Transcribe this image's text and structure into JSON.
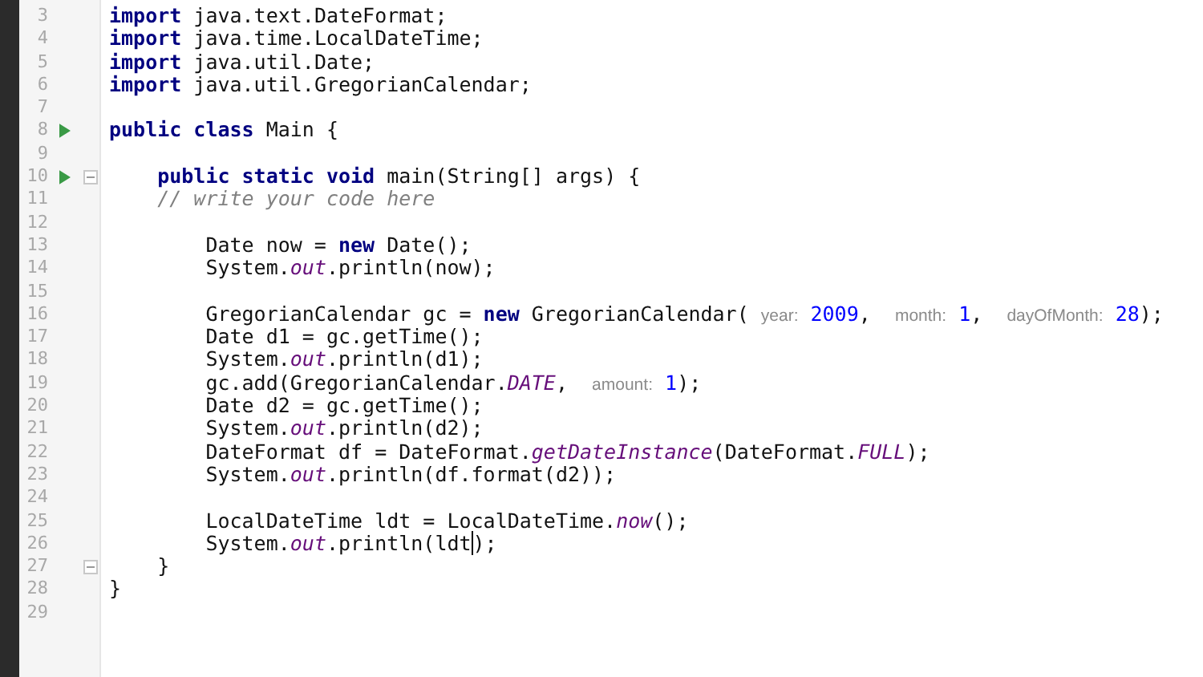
{
  "editor": {
    "lines": [
      {
        "number": "3",
        "run": false,
        "fold": false,
        "tokens": [
          {
            "kind": "kw",
            "text": "import"
          },
          {
            "kind": "plain",
            "text": " java.text.DateFormat;"
          }
        ]
      },
      {
        "number": "4",
        "run": false,
        "fold": false,
        "tokens": [
          {
            "kind": "kw",
            "text": "import"
          },
          {
            "kind": "plain",
            "text": " java.time.LocalDateTime;"
          }
        ]
      },
      {
        "number": "5",
        "run": false,
        "fold": false,
        "tokens": [
          {
            "kind": "kw",
            "text": "import"
          },
          {
            "kind": "plain",
            "text": " java.util.Date;"
          }
        ]
      },
      {
        "number": "6",
        "run": false,
        "fold": false,
        "tokens": [
          {
            "kind": "kw",
            "text": "import"
          },
          {
            "kind": "plain",
            "text": " java.util.GregorianCalendar;"
          }
        ]
      },
      {
        "number": "7",
        "run": false,
        "fold": false
      },
      {
        "number": "8",
        "run": true,
        "fold": false,
        "tokens": [
          {
            "kind": "kw",
            "text": "public class"
          },
          {
            "kind": "plain",
            "text": " Main {"
          }
        ]
      },
      {
        "number": "9",
        "run": false,
        "fold": false
      },
      {
        "number": "10",
        "run": true,
        "fold": true,
        "tokens": [
          {
            "kind": "kw",
            "text": "    public static void"
          },
          {
            "kind": "plain",
            "text": " main(String[] args) {"
          }
        ]
      },
      {
        "number": "11",
        "run": false,
        "fold": false,
        "tokens": [
          {
            "kind": "comment",
            "text": "    // write your code here"
          }
        ]
      },
      {
        "number": "12",
        "run": false,
        "fold": false
      },
      {
        "number": "13",
        "run": false,
        "fold": false,
        "tokens": [
          {
            "kind": "plain",
            "text": "        Date now = "
          },
          {
            "kind": "kw",
            "text": "new"
          },
          {
            "kind": "plain",
            "text": " Date();"
          }
        ]
      },
      {
        "number": "14",
        "run": false,
        "fold": false,
        "tokens": [
          {
            "kind": "plain",
            "text": "        System."
          },
          {
            "kind": "static",
            "text": "out"
          },
          {
            "kind": "plain",
            "text": ".println(now);"
          }
        ]
      },
      {
        "number": "15",
        "run": false,
        "fold": false
      },
      {
        "number": "16",
        "run": false,
        "fold": false,
        "tokens": [
          {
            "kind": "plain",
            "text": "        GregorianCalendar gc = "
          },
          {
            "kind": "kw",
            "text": "new"
          },
          {
            "kind": "plain",
            "text": " GregorianCalendar( "
          },
          {
            "kind": "hint",
            "text": "year:"
          },
          {
            "kind": "num",
            "text": " 2009"
          },
          {
            "kind": "plain",
            "text": ",  "
          },
          {
            "kind": "hint",
            "text": "month:"
          },
          {
            "kind": "num",
            "text": " 1"
          },
          {
            "kind": "plain",
            "text": ",  "
          },
          {
            "kind": "hint",
            "text": "dayOfMonth:"
          },
          {
            "kind": "num",
            "text": " 28"
          },
          {
            "kind": "plain",
            "text": ");"
          }
        ]
      },
      {
        "number": "17",
        "run": false,
        "fold": false,
        "tokens": [
          {
            "kind": "plain",
            "text": "        Date d1 = gc.getTime();"
          }
        ]
      },
      {
        "number": "18",
        "run": false,
        "fold": false,
        "tokens": [
          {
            "kind": "plain",
            "text": "        System."
          },
          {
            "kind": "static",
            "text": "out"
          },
          {
            "kind": "plain",
            "text": ".println(d1);"
          }
        ]
      },
      {
        "number": "19",
        "run": false,
        "fold": false,
        "tokens": [
          {
            "kind": "plain",
            "text": "        gc.add(GregorianCalendar."
          },
          {
            "kind": "static",
            "text": "DATE"
          },
          {
            "kind": "plain",
            "text": ",  "
          },
          {
            "kind": "hint",
            "text": "amount:"
          },
          {
            "kind": "num",
            "text": " 1"
          },
          {
            "kind": "plain",
            "text": ");"
          }
        ]
      },
      {
        "number": "20",
        "run": false,
        "fold": false,
        "tokens": [
          {
            "kind": "plain",
            "text": "        Date d2 = gc.getTime();"
          }
        ]
      },
      {
        "number": "21",
        "run": false,
        "fold": false,
        "tokens": [
          {
            "kind": "plain",
            "text": "        System."
          },
          {
            "kind": "static",
            "text": "out"
          },
          {
            "kind": "plain",
            "text": ".println(d2);"
          }
        ]
      },
      {
        "number": "22",
        "run": false,
        "fold": false,
        "tokens": [
          {
            "kind": "plain",
            "text": "        DateFormat df = DateFormat."
          },
          {
            "kind": "static",
            "text": "getDateInstance"
          },
          {
            "kind": "plain",
            "text": "(DateFormat."
          },
          {
            "kind": "static",
            "text": "FULL"
          },
          {
            "kind": "plain",
            "text": ");"
          }
        ]
      },
      {
        "number": "23",
        "run": false,
        "fold": false,
        "tokens": [
          {
            "kind": "plain",
            "text": "        System."
          },
          {
            "kind": "static",
            "text": "out"
          },
          {
            "kind": "plain",
            "text": ".println(df.format(d2));"
          }
        ]
      },
      {
        "number": "24",
        "run": false,
        "fold": false
      },
      {
        "number": "25",
        "run": false,
        "fold": false,
        "tokens": [
          {
            "kind": "plain",
            "text": "        LocalDateTime ldt = LocalDateTime."
          },
          {
            "kind": "static",
            "text": "now"
          },
          {
            "kind": "plain",
            "text": "();"
          }
        ]
      },
      {
        "number": "26",
        "run": false,
        "fold": false,
        "tokens": [
          {
            "kind": "plain",
            "text": "        System."
          },
          {
            "kind": "static",
            "text": "out"
          },
          {
            "kind": "caret",
            "text": ".println(ldt"
          },
          {
            "kind": "plain",
            "text": ");"
          }
        ]
      },
      {
        "number": "27",
        "run": false,
        "fold": true,
        "tokens": [
          {
            "kind": "plain",
            "text": "    }"
          }
        ]
      },
      {
        "number": "28",
        "run": false,
        "fold": false,
        "tokens": [
          {
            "kind": "plain",
            "text": "}"
          }
        ]
      },
      {
        "number": "29",
        "run": false,
        "fold": false
      }
    ]
  }
}
